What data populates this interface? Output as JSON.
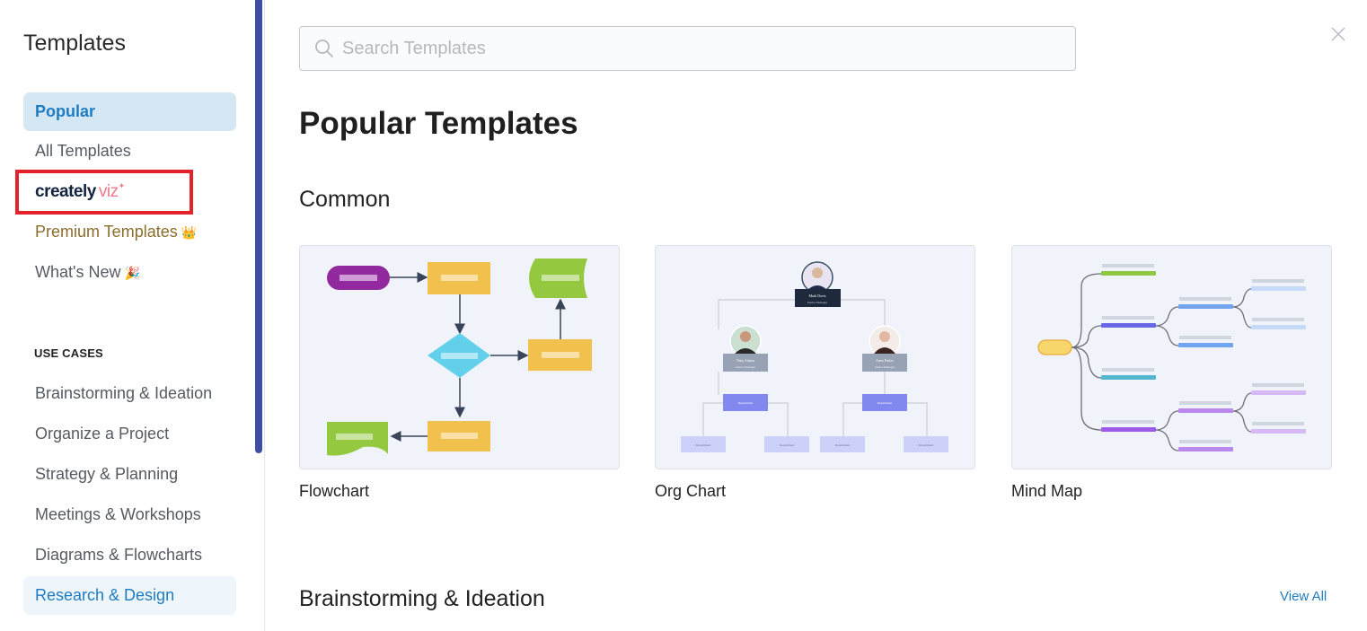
{
  "sidebar": {
    "title": "Templates",
    "items": [
      {
        "label": "Popular",
        "state": "active"
      },
      {
        "label": "All Templates"
      },
      {
        "label": "createlyviz",
        "logo_parts": [
          "creately",
          "viz"
        ],
        "highlighted": true
      },
      {
        "label": "Premium Templates",
        "emoji": "👑"
      },
      {
        "label": "What's New",
        "emoji": "🎉"
      }
    ],
    "use_cases_label": "USE CASES",
    "use_cases": [
      {
        "label": "Brainstorming & Ideation"
      },
      {
        "label": "Organize a Project"
      },
      {
        "label": "Strategy & Planning"
      },
      {
        "label": "Meetings & Workshops"
      },
      {
        "label": "Diagrams & Flowcharts"
      },
      {
        "label": "Research & Design",
        "state": "hover"
      }
    ]
  },
  "search": {
    "placeholder": "Search Templates",
    "value": ""
  },
  "main": {
    "title": "Popular Templates",
    "sections": [
      {
        "title": "Common",
        "cards": [
          {
            "label": "Flowchart",
            "preview": "flowchart"
          },
          {
            "label": "Org Chart",
            "preview": "org-chart",
            "people": [
              {
                "name": "Mark Davis",
                "role": "Senior Manager"
              },
              {
                "name": "Tony Adams",
                "role": "Senior Manager"
              },
              {
                "name": "Anna Parker",
                "role": "Senior Manager"
              }
            ],
            "department_label": "Department"
          },
          {
            "label": "Mind Map",
            "preview": "mind-map"
          }
        ]
      },
      {
        "title": "Brainstorming & Ideation",
        "view_all_label": "View All"
      }
    ]
  },
  "colors": {
    "accent": "#1e7cc2",
    "active_bg": "#d6e7f4",
    "highlight_box": "#e3222a",
    "scrollbar": "#3f4ea3",
    "premium": "#8a6d2d"
  }
}
